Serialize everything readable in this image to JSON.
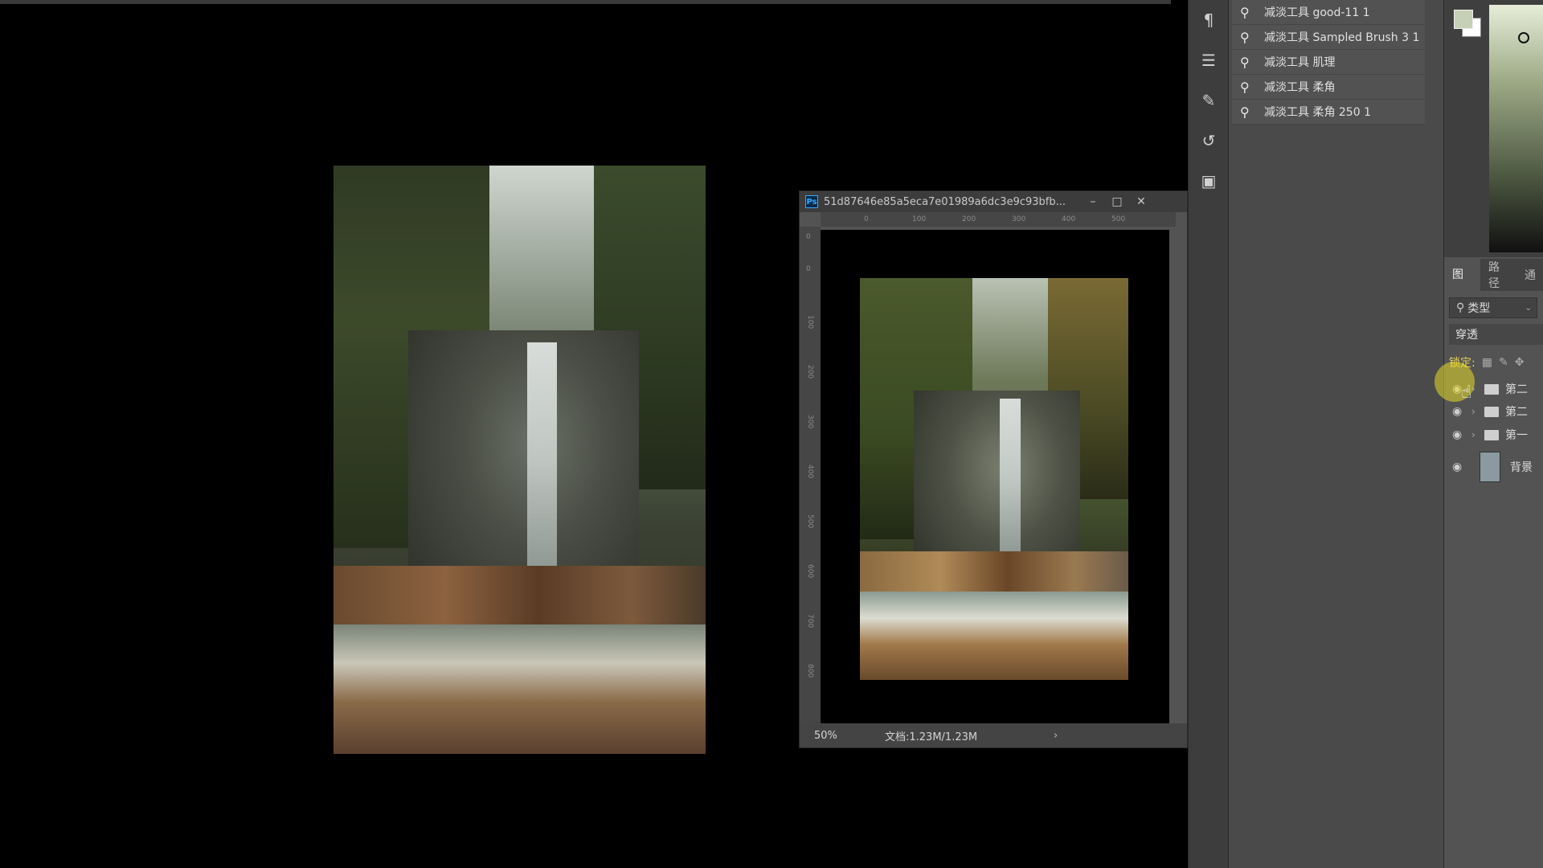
{
  "document_window": {
    "ps_badge": "Ps",
    "title": "51d87646e85a5eca7e01989a6dc3e9c93bfb...",
    "minimize_icon": "minimize-icon",
    "maximize_icon": "maximize-icon",
    "close_icon": "close-icon",
    "ruler_top_labels": [
      "0",
      "100",
      "200",
      "300",
      "400",
      "500"
    ],
    "ruler_left_labels": [
      "0",
      "0",
      "100",
      "200",
      "300",
      "400",
      "500",
      "600",
      "700",
      "800"
    ],
    "zoom": "50%",
    "doc_size": "文档:1.23M/1.23M",
    "status_arrow": "›"
  },
  "toolbar_icons": [
    "paragraph-icon",
    "adjust-icon",
    "brush-settings-icon",
    "clone-source-icon",
    "tool-preset-icon"
  ],
  "tool_presets": [
    {
      "label": "减淡工具 good-11 1"
    },
    {
      "label": "减淡工具 Sampled Brush 3 1"
    },
    {
      "label": "减淡工具 肌理"
    },
    {
      "label": "减淡工具 柔角"
    },
    {
      "label": "减淡工具 柔角 250 1"
    }
  ],
  "colors": {
    "foreground": "#c6d0b4",
    "background": "#ffffff"
  },
  "layers_panel": {
    "tabs": [
      "图层",
      "路径",
      "通"
    ],
    "filter_label": "类型",
    "blend_mode": "穿透",
    "lock_label": "锁定:",
    "layers": [
      {
        "name": "第二",
        "type": "group"
      },
      {
        "name": "第二",
        "type": "group"
      },
      {
        "name": "第一",
        "type": "group"
      },
      {
        "name": "背景",
        "type": "background"
      }
    ]
  }
}
